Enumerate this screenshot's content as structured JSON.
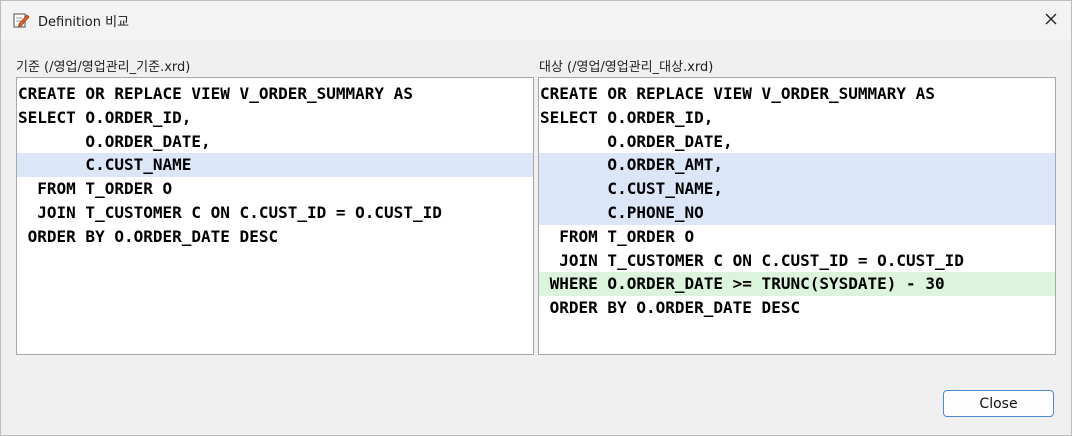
{
  "window": {
    "title": "Definition 비교",
    "close_glyph": "✕"
  },
  "left": {
    "label": "기준 (/영업/영업관리_기준.xrd)",
    "lines": [
      {
        "text": "CREATE OR REPLACE VIEW V_ORDER_SUMMARY AS",
        "state": "normal"
      },
      {
        "text": "SELECT O.ORDER_ID,",
        "state": "normal"
      },
      {
        "text": "       O.ORDER_DATE,",
        "state": "normal"
      },
      {
        "text": "       C.CUST_NAME",
        "state": "changed"
      },
      {
        "text": "  FROM T_ORDER O",
        "state": "normal"
      },
      {
        "text": "  JOIN T_CUSTOMER C ON C.CUST_ID = O.CUST_ID",
        "state": "normal"
      },
      {
        "text": " ORDER BY O.ORDER_DATE DESC",
        "state": "normal"
      }
    ]
  },
  "right": {
    "label": "대상 (/영업/영업관리_대상.xrd)",
    "lines": [
      {
        "text": "CREATE OR REPLACE VIEW V_ORDER_SUMMARY AS",
        "state": "normal"
      },
      {
        "text": "SELECT O.ORDER_ID,",
        "state": "normal"
      },
      {
        "text": "       O.ORDER_DATE,",
        "state": "normal"
      },
      {
        "text": "       O.ORDER_AMT,",
        "state": "changed"
      },
      {
        "text": "       C.CUST_NAME,",
        "state": "changed"
      },
      {
        "text": "       C.PHONE_NO",
        "state": "changed"
      },
      {
        "text": "  FROM T_ORDER O",
        "state": "normal"
      },
      {
        "text": "  JOIN T_CUSTOMER C ON C.CUST_ID = O.CUST_ID",
        "state": "normal"
      },
      {
        "text": " WHERE O.ORDER_DATE >= TRUNC(SYSDATE) - 30",
        "state": "added"
      },
      {
        "text": " ORDER BY O.ORDER_DATE DESC",
        "state": "normal"
      }
    ]
  },
  "footer": {
    "close_label": "Close"
  },
  "colors": {
    "changed_bg": "#dbe6f8",
    "added_bg": "#dcf3dc",
    "button_border": "#4a8bd1"
  }
}
